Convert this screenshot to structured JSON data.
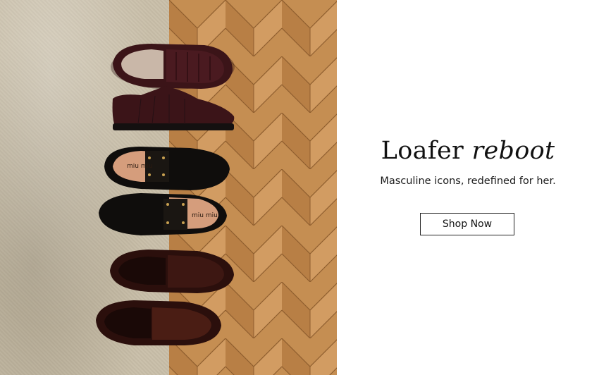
{
  "promo": {
    "headline_plain": "Loafer",
    "headline_italic": "reboot",
    "subtitle": "Masculine icons, redefined for her.",
    "cta_label": "Shop Now"
  },
  "hero_image": {
    "description_icon": "loafers-photo",
    "shoe_brand_marks": [
      "miu miu",
      "miu miu"
    ]
  },
  "colors": {
    "background": "#ffffff",
    "rug": "#c9bfa9",
    "floor": "#c58e52",
    "text": "#111111"
  }
}
